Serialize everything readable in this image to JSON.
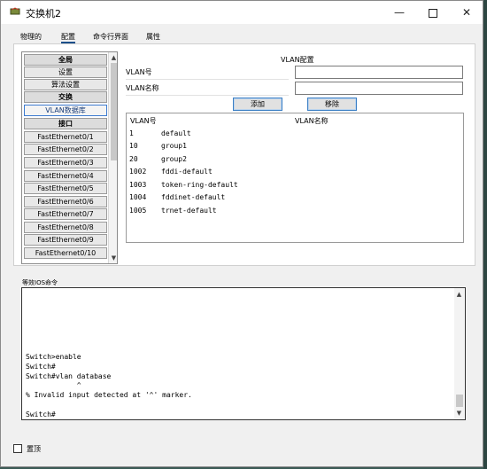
{
  "window": {
    "title": "交换机2",
    "controls": {
      "minimize": "—",
      "close": "✕"
    }
  },
  "tabs": [
    {
      "label": "物理的"
    },
    {
      "label": "配置"
    },
    {
      "label": "命令行界面"
    },
    {
      "label": "属性"
    }
  ],
  "sidebar": {
    "items": [
      {
        "label": "全局",
        "header": true
      },
      {
        "label": "设置"
      },
      {
        "label": "算法设置"
      },
      {
        "label": "交换",
        "header": true
      },
      {
        "label": "VLAN数据库",
        "selected": true
      },
      {
        "label": "接口",
        "header": true
      },
      {
        "label": "FastEthernet0/1"
      },
      {
        "label": "FastEthernet0/2"
      },
      {
        "label": "FastEthernet0/3"
      },
      {
        "label": "FastEthernet0/4"
      },
      {
        "label": "FastEthernet0/5"
      },
      {
        "label": "FastEthernet0/6"
      },
      {
        "label": "FastEthernet0/7"
      },
      {
        "label": "FastEthernet0/8"
      },
      {
        "label": "FastEthernet0/9"
      },
      {
        "label": "FastEthernet0/10"
      }
    ],
    "scroll_up": "▲",
    "scroll_down": "▼"
  },
  "vlan_config": {
    "title": "VLAN配置",
    "vlan_number_label": "VLAN号",
    "vlan_number_value": "",
    "vlan_name_label": "VLAN名称",
    "vlan_name_value": "",
    "add_button": "添加",
    "remove_button": "移除",
    "table": {
      "headers": [
        "VLAN号",
        "VLAN名称"
      ],
      "rows": [
        {
          "id": "1",
          "name": "default"
        },
        {
          "id": "10",
          "name": "group1"
        },
        {
          "id": "20",
          "name": "group2"
        },
        {
          "id": "1002",
          "name": "fddi-default"
        },
        {
          "id": "1003",
          "name": "token-ring-default"
        },
        {
          "id": "1004",
          "name": "fddinet-default"
        },
        {
          "id": "1005",
          "name": "trnet-default"
        }
      ]
    }
  },
  "ios_console": {
    "label": "等效IOS命令",
    "lines": [
      "Switch>enable",
      "Switch#",
      "Switch#vlan database",
      "            ^",
      "% Invalid input detected at '^' marker.",
      "",
      "Switch#"
    ],
    "scroll_up": "▲",
    "scroll_down": "▼"
  },
  "footer": {
    "checkbox_label": "置顶",
    "checked": false
  }
}
